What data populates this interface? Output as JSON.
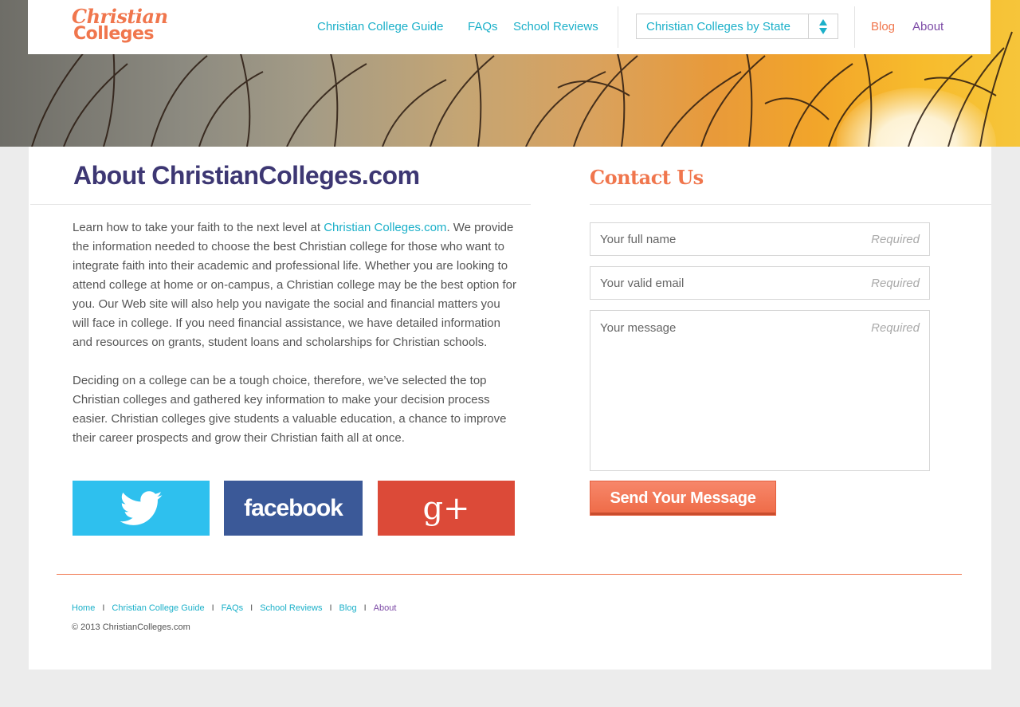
{
  "header": {
    "logo_line1": "Christian",
    "logo_line2": "Colleges",
    "nav": [
      {
        "label": "Christian College Guide"
      },
      {
        "label": "FAQs"
      },
      {
        "label": "School Reviews"
      }
    ],
    "state_select": {
      "value": "Christian Colleges by State"
    },
    "blog_label": "Blog",
    "about_label": "About"
  },
  "colors": {
    "teal": "#1bb0c9",
    "orange": "#f0764d",
    "purple": "#3d3773",
    "about_nav": "#7c4aa6",
    "twitter": "#2ec0ee",
    "facebook": "#3b5998",
    "google_plus": "#dc4a38"
  },
  "about": {
    "title": "About ChristianColleges.com",
    "p1_before": "Learn how to take your faith to the next level at ",
    "p1_link": "Christian Colleges.com",
    "p1_after": ". We provide the information needed to choose the best Christian college for those who want to integrate faith into their academic and professional life. Whether you are looking to attend college at home or on-campus, a Christian college may be the best option for you. Our Web site will also help you navigate the social and financial matters you will face in college. If you need financial assistance, we have detailed information and resources on grants, student loans and scholarships for Christian schools.",
    "p2": "Deciding on a college can be a tough choice, therefore, we’ve selected the top Christian colleges and gathered key information to make your decision process easier. Christian colleges give students a valuable education, a chance to improve their career prospects and grow their Christian faith all at once."
  },
  "social": {
    "twitter_icon": "twitter-bird-icon",
    "facebook_label": "facebook",
    "googleplus_label": "g+"
  },
  "contact": {
    "title": "Contact Us",
    "name_placeholder": "Your full name",
    "email_placeholder": "Your valid email",
    "message_placeholder": "Your message",
    "required": "Required",
    "send_label": "Send Your Message"
  },
  "footer": {
    "links": [
      "Home",
      "Christian College Guide",
      "FAQs",
      "School Reviews",
      "Blog",
      "About"
    ],
    "separator": "I",
    "copyright": "© 2013 ChristianColleges.com"
  }
}
